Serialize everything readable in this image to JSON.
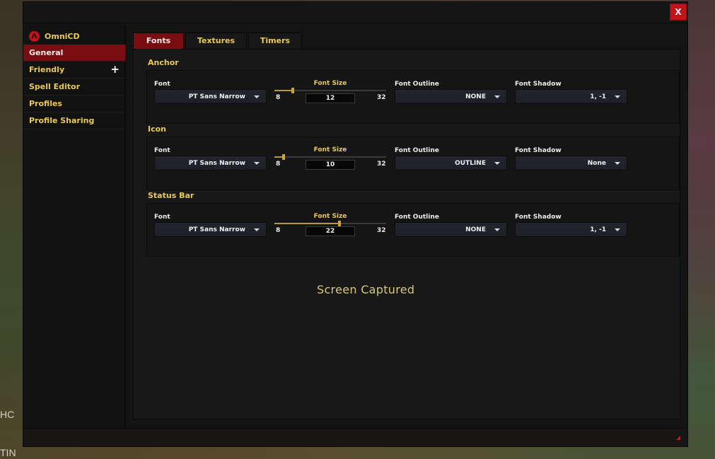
{
  "background": {
    "left_text_1": "HC",
    "left_text_2": "TIN"
  },
  "window": {
    "close_label": "X"
  },
  "sidebar": {
    "brand": "OmniCD",
    "brand_logo_glyph": "Λ",
    "items": [
      {
        "label": "General",
        "active": true
      },
      {
        "label": "Friendly",
        "expand": "+"
      },
      {
        "label": "Spell Editor"
      },
      {
        "label": "Profiles"
      },
      {
        "label": "Profile Sharing"
      }
    ]
  },
  "tabs": [
    {
      "label": "Fonts",
      "active": true
    },
    {
      "label": "Textures"
    },
    {
      "label": "Timers"
    }
  ],
  "groups": [
    {
      "title": "Anchor",
      "font": {
        "label": "Font",
        "value": "PT Sans Narrow"
      },
      "font_size": {
        "label": "Font Size",
        "min": "8",
        "max": "32",
        "value": "12",
        "fraction": 0.1667
      },
      "outline": {
        "label": "Font Outline",
        "value": "NONE"
      },
      "shadow": {
        "label": "Font Shadow",
        "value": "1, -1"
      }
    },
    {
      "title": "Icon",
      "font": {
        "label": "Font",
        "value": "PT Sans Narrow"
      },
      "font_size": {
        "label": "Font Size",
        "min": "8",
        "max": "32",
        "value": "10",
        "fraction": 0.0833
      },
      "outline": {
        "label": "Font Outline",
        "value": "OUTLINE"
      },
      "shadow": {
        "label": "Font Shadow",
        "value": "None"
      }
    },
    {
      "title": "Status Bar",
      "font": {
        "label": "Font",
        "value": "PT Sans Narrow"
      },
      "font_size": {
        "label": "Font Size",
        "min": "8",
        "max": "32",
        "value": "22",
        "fraction": 0.5833
      },
      "outline": {
        "label": "Font Outline",
        "value": "NONE"
      },
      "shadow": {
        "label": "Font Shadow",
        "value": "1, -1"
      }
    }
  ],
  "overlay": {
    "text": "Screen Captured"
  },
  "colors": {
    "accent_red": "#7a0d12",
    "close_red": "#c0141b",
    "gold": "#e8c95a"
  }
}
